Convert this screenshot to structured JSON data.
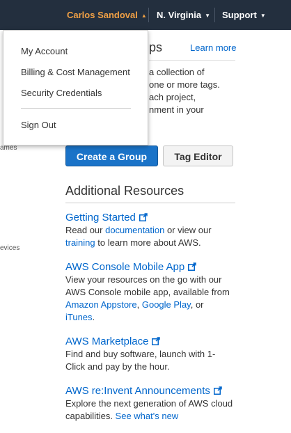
{
  "nav": {
    "user_name": "Carlos Sandoval",
    "region": "N. Virginia",
    "support": "Support"
  },
  "user_menu": {
    "items": [
      "My Account",
      "Billing & Cost Management",
      "Security Credentials"
    ],
    "sign_out": "Sign Out"
  },
  "sidebar_fragments": [
    "ames",
    "evices"
  ],
  "resource_groups": {
    "title_partial": "ps",
    "learn_more": "Learn more",
    "intro_lines": [
      "a collection of",
      "one or more tags.",
      "ach project,",
      "nment in your"
    ],
    "create_button": "Create a Group",
    "tag_editor_button": "Tag Editor"
  },
  "additional_resources": {
    "title": "Additional Resources",
    "getting_started": {
      "title": "Getting Started",
      "t1": "Read our ",
      "l1": "documentation",
      "t2": " or view our",
      "l2": "training",
      "t3": " to learn more about AWS."
    },
    "mobile_app": {
      "title": "AWS Console Mobile App",
      "t1": "View your resources on the go with our",
      "t2": "AWS Console mobile app, available from",
      "l1": "Amazon Appstore",
      "t3": ", ",
      "l2": "Google Play",
      "t4": ", or",
      "l3": "iTunes",
      "t5": "."
    },
    "marketplace": {
      "title": "AWS Marketplace",
      "t1": "Find and buy software, launch with 1-",
      "t2": "Click and pay by the hour."
    },
    "reinvent": {
      "title": "AWS re:Invent Announcements",
      "t1": "Explore the next generation of AWS cloud",
      "t2": "capabilities. ",
      "l1": "See what's new"
    }
  },
  "colors": {
    "topbar": "#232f3e",
    "user_accent": "#f0a045",
    "link": "#0066cc",
    "primary_button": "#1a73c8"
  },
  "icons": {
    "external_link": "external-link-icon",
    "caret": "caret-down-icon"
  }
}
